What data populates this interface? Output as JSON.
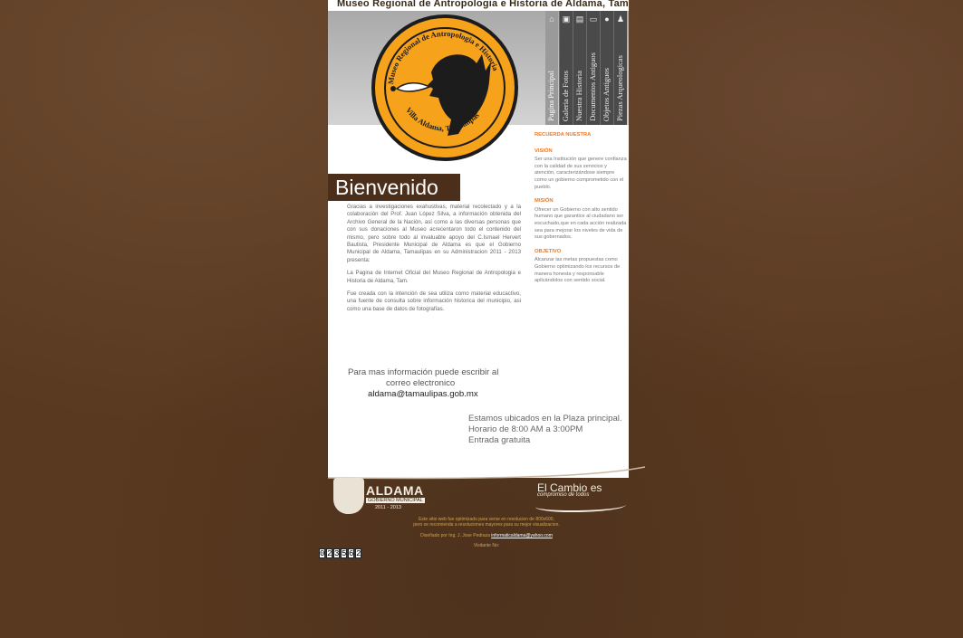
{
  "site": {
    "title": "Museo Regional de Antropologia e Historia de Aldama, Tam."
  },
  "logo": {
    "top_text": "Museo Regional de Antropologia e Historia",
    "bottom_text": "Villa Aldama, Tamaulipas"
  },
  "nav": {
    "items": [
      {
        "label": "Pagina Principal",
        "icon": "home-icon"
      },
      {
        "label": "Galeria de Fotos",
        "icon": "camera-icon"
      },
      {
        "label": "Nuestra Historia",
        "icon": "book-icon"
      },
      {
        "label": "Documentos Antiguos",
        "icon": "document-icon"
      },
      {
        "label": "Objetos Antiguos",
        "icon": "pot-icon"
      },
      {
        "label": "Piezas Arqueologicas",
        "icon": "figure-icon"
      }
    ]
  },
  "welcome": {
    "heading": "Bienvenido",
    "paragraphs": [
      "Gracias a investigaciones exahustivas, material recolectado y a la colaboración del Prof. Juan López Silva, a información obtenida del Archivo General de la Nación, así como a las diversas personas que con sus donaciones al Museo acrecentaron todo el contenido del mismo, pero sobre todo al invaluable apoyo del C.Ismael Hervert Bautista, Presidente Municipal de Aldama es que el Gobierno Municipal de Aldama, Tamaulipas en su Administracion 2011 - 2013 presenta:",
      "La Pagina de Internet Oficial del Museo Regional de Antropologia e Historia de Aldama, Tam.",
      "Fue creada con la intención de sea utiliza como material educactivo, una fuente de consulta sobre información historica del municipio, asi como una base de datos de fotografías."
    ]
  },
  "sidebar": {
    "heading": "RECUERDA NUESTRA",
    "sections": [
      {
        "title": "VISIÓN",
        "text": "Ser una Institución que genere confianza con la calidad de sus servicios y atención, caracterizándose siempre como un gobierno comprometido con el pueblo."
      },
      {
        "title": "MISIÓN",
        "text": "Ofrecer un Gobierno con alto sentido humano que garantice al ciudadano ser escuchado,que en cada acción realizada sea para mejorar los niveles de vida de sus gobernados."
      },
      {
        "title": "OBJETIVO",
        "text": "Alcanzar las metas propuestas como Gobierno optimizando los recursos de manera honesta y responsable aplicándolos con sentido social."
      }
    ]
  },
  "contact": {
    "line1": "Para mas información puede escribir al",
    "line2": "correo electronico",
    "email": "aldama@tamaulipas.gob.mx"
  },
  "location": {
    "line1": "Estamos ubicados en la Plaza principal.",
    "line2": "Horario de 8:00 AM a 3:00PM",
    "line3": "Entrada gratuita"
  },
  "footer_logos": {
    "aldama_title": "ALDAMA",
    "aldama_sub": "GOBIERNO MUNICIPAL",
    "aldama_years": "2011 - 2013",
    "cambio_title": "El Cambio es",
    "cambio_sub": "compromiso de todos"
  },
  "footer": {
    "note1": "Este sitio web fue optimizado para verse en resolucion de 800x600,",
    "note2": "pero se recomienda a resoluciones mayores para su mejor visualizacion.",
    "designed_by": "Diseñado por Ing. J. Jose Pedraza",
    "designer_email": "informaticaldama@yahoo.com",
    "visitors_label": "Visitante No:",
    "counter": [
      "0",
      "2",
      "3",
      "5",
      "6",
      "2"
    ]
  }
}
